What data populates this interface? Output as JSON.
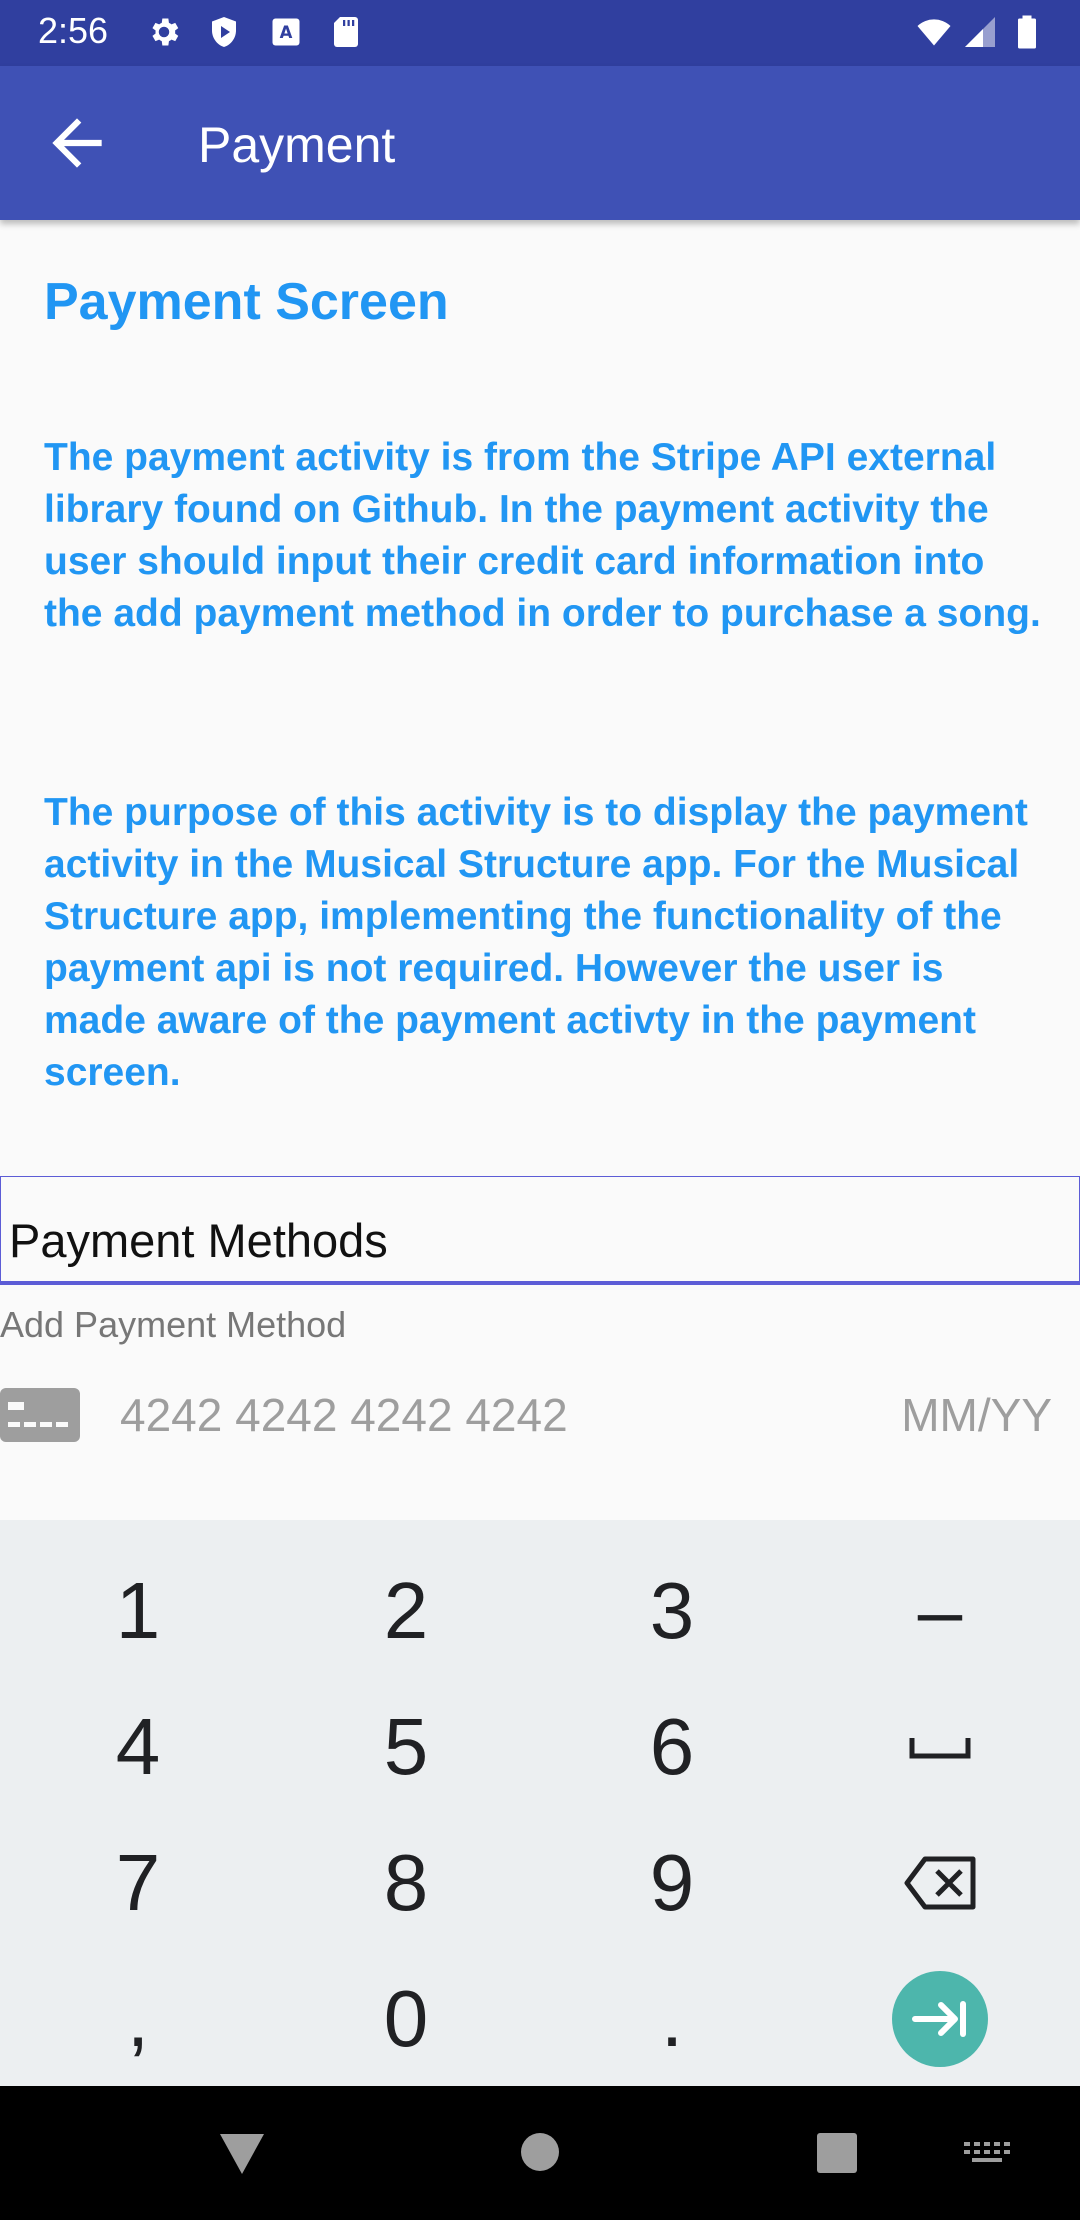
{
  "status_bar": {
    "time": "2:56",
    "icons": [
      "settings-icon",
      "play-protect-icon",
      "keyboard-a-icon",
      "sd-card-icon",
      "wifi-icon",
      "signal-icon",
      "battery-icon"
    ]
  },
  "app_bar": {
    "title": "Payment",
    "back_icon": "arrow-left-icon",
    "color": "#3f51b5"
  },
  "content": {
    "screen_title": "Payment Screen",
    "paragraph1": "The payment activity is from the Stripe API external library found on Github. In the payment activity the user should input their credit card information into the add payment method in order to purchase a song.",
    "paragraph2": "The purpose of this activity is to display the payment activity in the Musical Structure app. For the Musical Structure app, implementing the functionality of the payment api is not required. However the user is made aware of the payment activty in the payment screen.",
    "accent_color": "#2196f3"
  },
  "payment": {
    "methods_label": "Payment Methods",
    "add_method_label": "Add Payment Method",
    "card_number_placeholder": "4242 4242 4242 4242",
    "expiry_placeholder": "MM/YY"
  },
  "keyboard": {
    "keys": [
      "1",
      "2",
      "3",
      "–",
      "4",
      "5",
      "6",
      "␣",
      "7",
      "8",
      "9",
      "⌫",
      ",",
      "0",
      ".",
      "⇥"
    ],
    "action_color": "#4db6ac"
  },
  "nav_bar": {
    "icons": [
      "back-triangle-icon",
      "home-circle-icon",
      "recents-square-icon",
      "keyboard-switch-icon"
    ]
  }
}
